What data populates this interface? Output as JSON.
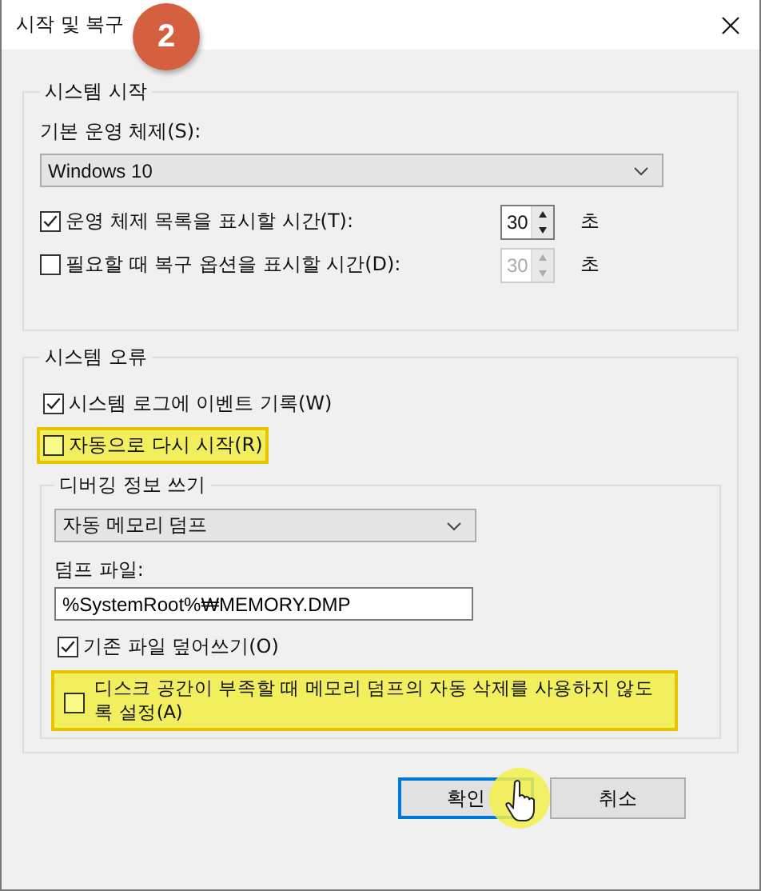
{
  "window": {
    "title": "시작 및 복구"
  },
  "step_badge": "2",
  "startup": {
    "title": "시스템 시작",
    "os_label": "기본 운영 체제(S):",
    "os_value": "Windows 10",
    "rows": [
      {
        "label": "운영 체제 목록을 표시할 시간(T):",
        "checked": true,
        "value": "30",
        "disabled": false,
        "unit": "초"
      },
      {
        "label": "필요할 때 복구 옵션을 표시할 시간(D):",
        "checked": false,
        "value": "30",
        "disabled": true,
        "unit": "초"
      }
    ]
  },
  "failure": {
    "title": "시스템 오류",
    "options": [
      {
        "label": "시스템 로그에 이벤트 기록(W)",
        "checked": true,
        "highlighted": false
      },
      {
        "label": "자동으로 다시 시작(R)",
        "checked": false,
        "highlighted": true
      }
    ],
    "debug": {
      "title": "디버깅 정보 쓰기",
      "dump_type": "자동 메모리 덤프",
      "file_label": "덤프 파일:",
      "file_value": "%SystemRoot%₩MEMORY.DMP",
      "options": [
        {
          "label": "기존 파일 덮어쓰기(O)",
          "checked": true,
          "highlighted": false
        },
        {
          "label": "디스크 공간이 부족할 때 메모리 덤프의 자동 삭제를 사용하지 않도록 설정(A)",
          "checked": false,
          "highlighted": true
        }
      ]
    }
  },
  "buttons": [
    {
      "label": "확인",
      "default": true,
      "pointer": true
    },
    {
      "label": "취소",
      "default": false,
      "pointer": false
    }
  ]
}
